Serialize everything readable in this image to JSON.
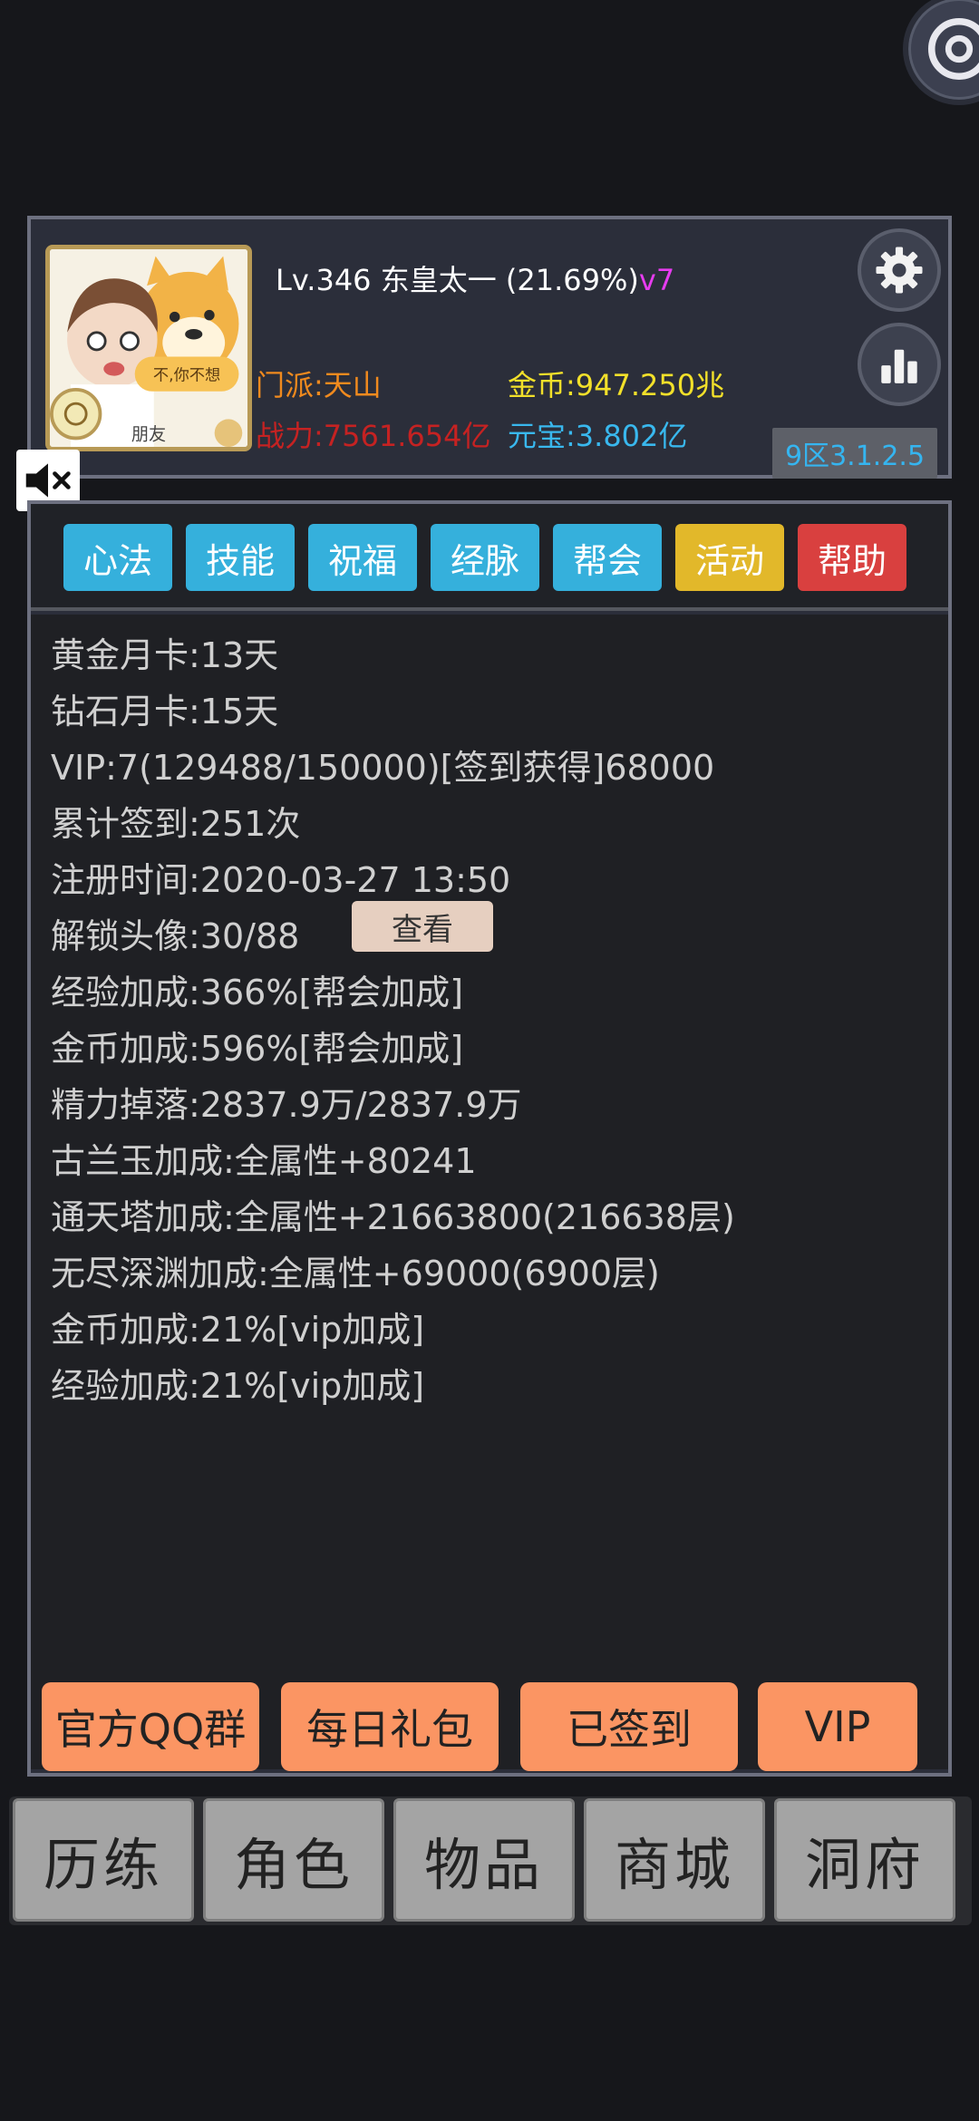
{
  "corner_widget": {
    "icon": "at-icon"
  },
  "profile": {
    "level": "Lv.346",
    "name": "东皇太一",
    "exp_pct": "(21.69%)",
    "vip_tag": "v7",
    "sect": "门派:天山",
    "power": "战力:7561.654亿",
    "gold": "金币:947.250兆",
    "ingot": "元宝:3.802亿",
    "server": "9区3.1.2.5",
    "avatar_caption": "不,你不想",
    "avatar_name": "朋友"
  },
  "tabs": [
    {
      "label": "心法",
      "color": "#35b0dc"
    },
    {
      "label": "技能",
      "color": "#35b0dc"
    },
    {
      "label": "祝福",
      "color": "#35b0dc"
    },
    {
      "label": "经脉",
      "color": "#35b0dc"
    },
    {
      "label": "帮会",
      "color": "#35b0dc"
    },
    {
      "label": "活动",
      "color": "#e2b82a"
    },
    {
      "label": "帮助",
      "color": "#d9403f"
    }
  ],
  "info": {
    "lines": [
      "黄金月卡:13天",
      "钻石月卡:15天",
      "VIP:7(129488/150000)[签到获得]68000",
      "累计签到:251次",
      "注册时间:2020-03-27 13:50",
      "解锁头像:30/88",
      "经验加成:366%[帮会加成]",
      "金币加成:596%[帮会加成]",
      "精力掉落:2837.9万/2837.9万",
      "古兰玉加成:全属性+80241",
      "通天塔加成:全属性+21663800(216638层)",
      "无尽深渊加成:全属性+69000(6900层)",
      "金币加成:21%[vip加成]",
      "经验加成:21%[vip加成]"
    ],
    "view_button": "查看"
  },
  "actions": [
    "官方QQ群",
    "每日礼包",
    "已签到",
    "VIP"
  ],
  "bottom_nav": [
    "历练",
    "角色",
    "物品",
    "商城",
    "洞府"
  ],
  "colors": {
    "background": "#16171b",
    "panel": "#2b2e3a",
    "action_orange": "#fb9563",
    "vip_magenta": "#e73cf0"
  }
}
